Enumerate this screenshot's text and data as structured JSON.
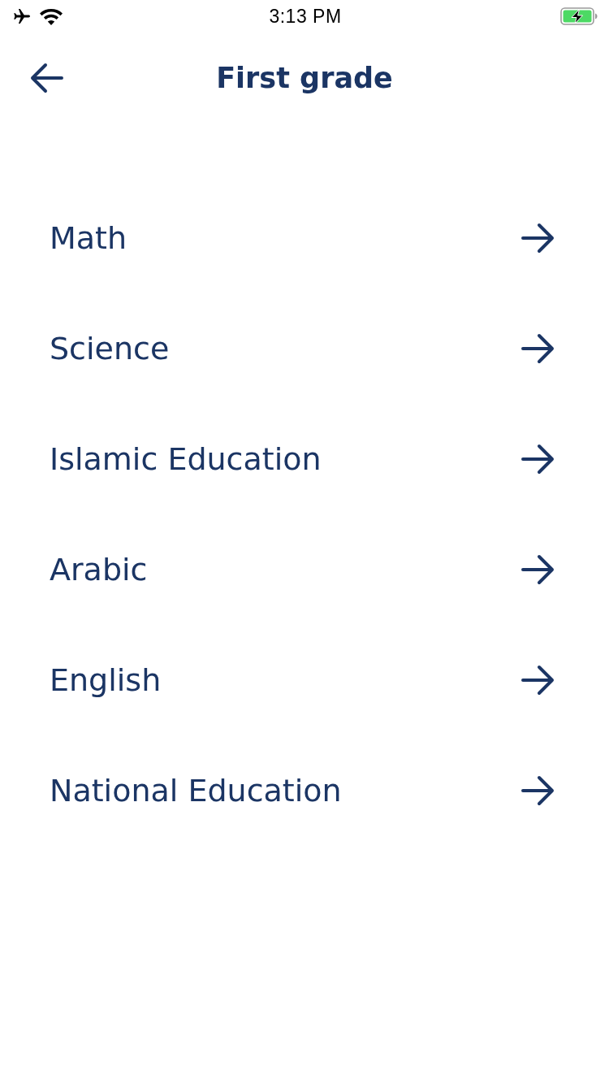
{
  "status_bar": {
    "time": "3:13 PM"
  },
  "header": {
    "title": "First grade"
  },
  "subjects": [
    {
      "label": "Math"
    },
    {
      "label": "Science"
    },
    {
      "label": "Islamic Education"
    },
    {
      "label": "Arabic"
    },
    {
      "label": "English"
    },
    {
      "label": "National Education"
    }
  ]
}
